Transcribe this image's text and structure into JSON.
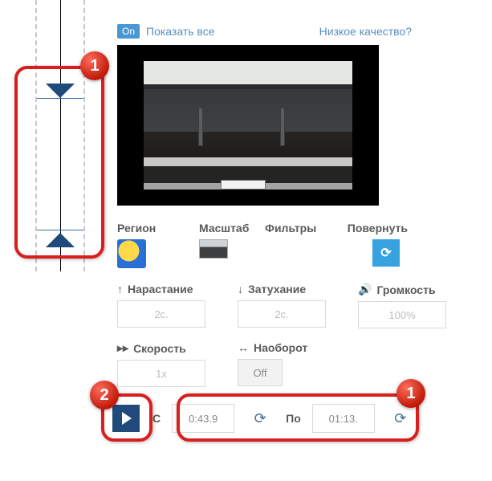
{
  "top": {
    "on": "On",
    "show_all": "Показать все",
    "low_quality": "Низкое качество?"
  },
  "section1": {
    "region": "Регион",
    "scale": "Масштаб",
    "filters": "Фильтры",
    "rotate": "Повернуть"
  },
  "sliders": {
    "fadeIn": {
      "label": "Нарастание",
      "value": "2с."
    },
    "fadeOut": {
      "label": "Затухание",
      "value": "2с."
    },
    "volume": {
      "label": "Громкость",
      "value": "100%"
    }
  },
  "extra": {
    "speed": {
      "label": "Скорость",
      "value": "1x"
    },
    "reverse": {
      "label": "Наоборот",
      "value": "Off"
    }
  },
  "timeline": {
    "from_label": "С",
    "to_label": "По",
    "from": "0:43.9",
    "to": "01:13."
  },
  "badges": {
    "one": "1",
    "two": "2",
    "one_b": "1"
  }
}
